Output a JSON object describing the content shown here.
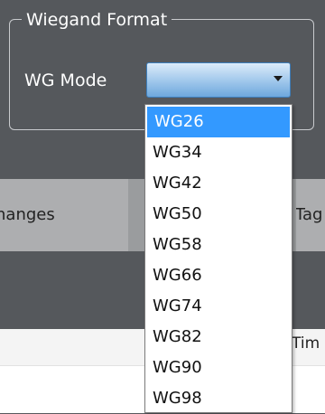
{
  "group": {
    "title": "Wiegand Format"
  },
  "wg_mode": {
    "label": "WG Mode",
    "selected": "",
    "options": [
      "WG26",
      "WG34",
      "WG42",
      "WG50",
      "WG58",
      "WG66",
      "WG74",
      "WG82",
      "WG90",
      "WG98"
    ],
    "highlighted": "WG26"
  },
  "buttons": {
    "left": "hanges",
    "right": "Tag"
  },
  "grid": {
    "visible_column": "Tim"
  }
}
